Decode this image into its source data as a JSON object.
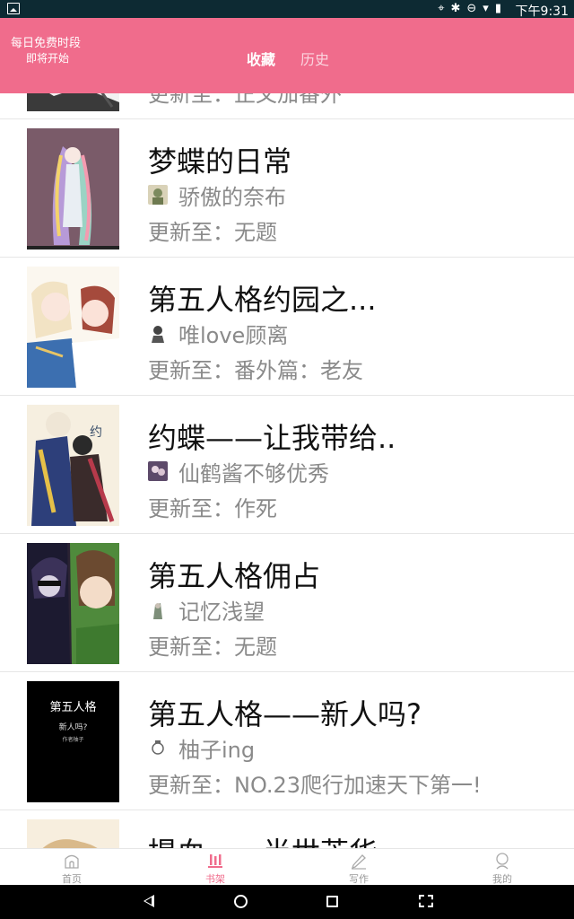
{
  "status_bar": {
    "time": "下午9:31"
  },
  "header": {
    "free_line1": "每日免费时段",
    "free_line2": "即将开始",
    "tabs": [
      {
        "label": "收藏",
        "active": true
      },
      {
        "label": "历史",
        "active": false
      }
    ],
    "accent_color": "#f06c8c"
  },
  "shelf": {
    "partial_top": {
      "update": "更新至：正文加番外"
    },
    "books": [
      {
        "title": "梦蝶的日常",
        "author": "骄傲的奈布",
        "update": "更新至：无题"
      },
      {
        "title": "第五人格约园之...",
        "author": "唯love顾离",
        "update": "更新至：番外篇：老友"
      },
      {
        "title": "约蝶——让我带给..",
        "author": "仙鹤酱不够优秀",
        "update": "更新至：作死"
      },
      {
        "title": "第五人格佣占",
        "author": "记忆浅望",
        "update": "更新至：无题"
      },
      {
        "title": "第五人格——新人吗?",
        "author": "柚子ing",
        "update": "更新至：NO.23爬行加速天下第一!",
        "cover_text": [
          "第五人格",
          "新人吗?",
          "作者柚子"
        ]
      }
    ],
    "partial_bottom": {
      "title": "提血——半世芳华"
    }
  },
  "tabbar": {
    "items": [
      {
        "label": "首页",
        "icon": "home-icon"
      },
      {
        "label": "书架",
        "icon": "bookshelf-icon",
        "active": true
      },
      {
        "label": "写作",
        "icon": "pencil-icon"
      },
      {
        "label": "我的",
        "icon": "profile-icon"
      }
    ]
  }
}
